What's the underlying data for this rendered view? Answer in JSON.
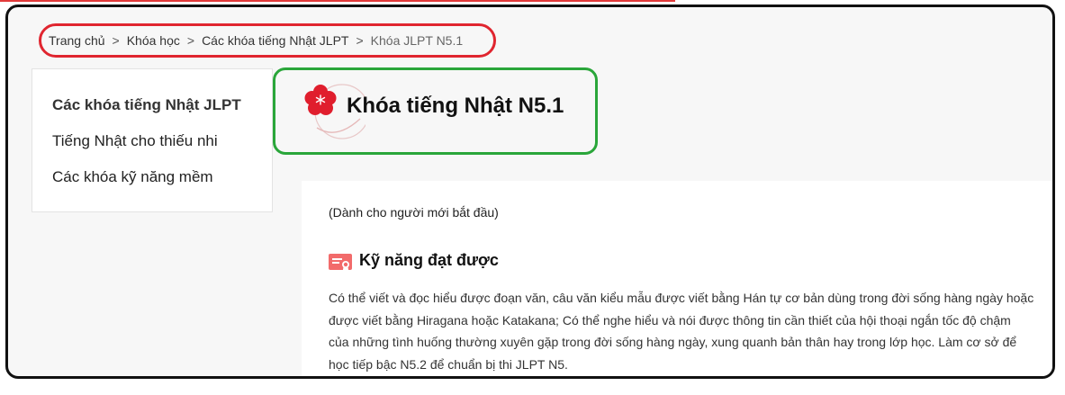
{
  "breadcrumb": {
    "items": [
      "Trang chủ",
      "Khóa học",
      "Các khóa tiếng Nhật JLPT"
    ],
    "current": "Khóa JLPT N5.1",
    "separator": ">"
  },
  "sidebar": {
    "items": [
      {
        "label": "Các khóa tiếng Nhật JLPT",
        "active": true
      },
      {
        "label": "Tiếng Nhật cho thiếu nhi",
        "active": false
      },
      {
        "label": "Các khóa kỹ năng mềm",
        "active": false
      }
    ]
  },
  "header": {
    "title": "Khóa tiếng Nhật N5.1",
    "logo_icon": "sakura-flower-icon"
  },
  "main": {
    "subtitle": "(Dành cho người mới bắt đầu)",
    "section_title": "Kỹ năng đạt được",
    "section_icon": "certificate-icon",
    "description_lines": [
      "Có thể viết và đọc hiểu được đoạn văn, câu văn kiểu mẫu được viết bằng Hán tự cơ bản dùng trong đời sống hàng ngày hoặc",
      "được viết bằng Hiragana hoặc Katakana; Có thể nghe hiểu và nói được thông tin cần thiết của hội thoại ngắn tốc độ chậm",
      "của những tình huống thường xuyên gặp trong đời sống hàng ngày, xung quanh bản thân hay trong lớp học. Làm cơ sở để",
      "học tiếp bậc N5.2 để chuẩn bị thi JLPT N5."
    ]
  },
  "colors": {
    "breadcrumb_highlight": "#e0252f",
    "title_highlight": "#2aa63a",
    "frame_border": "#111111",
    "accent_red": "#e01e2d"
  }
}
